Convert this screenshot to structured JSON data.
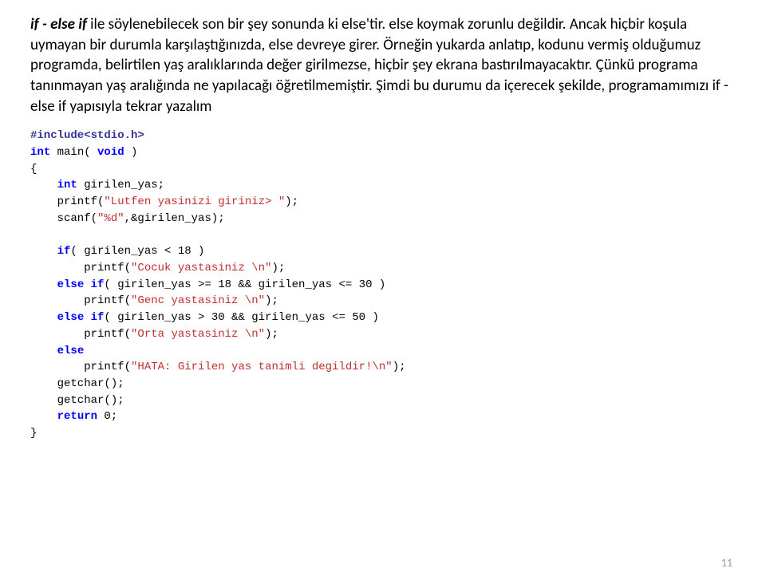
{
  "paragraph": {
    "lead_bold_italic": "if - else if",
    "body": " ile söylenebilecek son bir şey sonunda ki else'tir. else koymak zorunlu değildir. Ancak hiçbir koşula uymayan bir durumla karşılaştığınızda, else devreye girer. Örneğin yukarda anlatıp, kodunu vermiş olduğumuz programda, belirtilen yaş aralıklarında değer girilmezse, hiçbir şey ekrana bastırılmayacaktır. Çünkü programa tanınmayan yaş aralığında ne yapılacağı öğretilmemiştir. Şimdi bu durumu da içerecek şekilde, programamımızı if - else if yapısıyla tekrar yazalım"
  },
  "code": {
    "line01a": "#include<stdio.h>",
    "line02a": "int",
    "line02b": " main( ",
    "line02c": "void",
    "line02d": " )",
    "line03a": "{",
    "line04a": "    ",
    "line04b": "int",
    "line04c": " girilen_yas;",
    "line05a": "    printf(",
    "line05b": "\"Lutfen yasinizi giriniz> \"",
    "line05c": ");",
    "line06a": "    scanf(",
    "line06b": "\"%d\"",
    "line06c": ",&girilen_yas);",
    "line07a": "",
    "line08a": "    ",
    "line08b": "if",
    "line08c": "( girilen_yas < 18 )",
    "line09a": "        printf(",
    "line09b": "\"Cocuk yastasiniz \\n\"",
    "line09c": ");",
    "line10a": "    ",
    "line10b": "else if",
    "line10c": "( girilen_yas >= 18 && girilen_yas <= 30 )",
    "line11a": "        printf(",
    "line11b": "\"Genc yastasiniz \\n\"",
    "line11c": ");",
    "line12a": "    ",
    "line12b": "else if",
    "line12c": "( girilen_yas > 30 && girilen_yas <= 50 )",
    "line13a": "        printf(",
    "line13b": "\"Orta yastasiniz \\n\"",
    "line13c": ");",
    "line14a": "    ",
    "line14b": "else",
    "line15a": "        printf(",
    "line15b": "\"HATA: Girilen yas tanimli degildir!\\n\"",
    "line15c": ");",
    "line16a": "    getchar();",
    "line17a": "    getchar();",
    "line18a": "    ",
    "line18b": "return",
    "line18c": " 0;",
    "line19a": "}"
  },
  "page_number": "11"
}
